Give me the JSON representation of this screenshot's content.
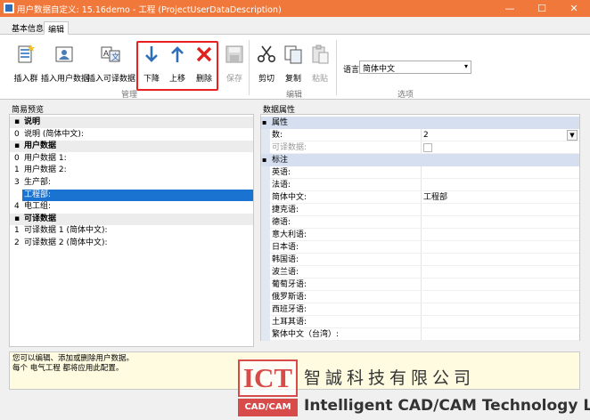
{
  "window": {
    "title": "用户数据自定义: 15.16demo - 工程 (ProjectUserDataDescription)",
    "minimize": "—",
    "maximize": "☐",
    "close": "✕"
  },
  "ribbon_tabs": [
    "基本信息",
    "编辑"
  ],
  "ribbon": {
    "manage": {
      "label": "管理",
      "insert_group": "插入群",
      "insert_user_data": "插入用户数据",
      "insert_translatable": "插入可译数据",
      "move_down": "下降",
      "move_up": "上移",
      "delete": "删除",
      "save": "保存"
    },
    "edit": {
      "label": "编辑",
      "cut": "剪切",
      "copy": "复制",
      "paste": "粘贴"
    },
    "options": {
      "label": "选项",
      "language_label": "语言",
      "language_value": "简体中文"
    }
  },
  "left_pane": {
    "title": "简易预览",
    "rows": [
      {
        "num": "",
        "text": "说明",
        "kind": "header"
      },
      {
        "num": "0",
        "text": "说明 (简体中文):",
        "kind": "row"
      },
      {
        "num": "",
        "text": "用户数据",
        "kind": "header"
      },
      {
        "num": "0",
        "text": "用户数据 1:",
        "kind": "row"
      },
      {
        "num": "1",
        "text": "用户数据 2:",
        "kind": "row"
      },
      {
        "num": "3",
        "text": "生产部:",
        "kind": "row"
      },
      {
        "num": "",
        "text": "工程部:",
        "kind": "selected"
      },
      {
        "num": "4",
        "text": "电工组:",
        "kind": "row"
      },
      {
        "num": "",
        "text": "可译数据",
        "kind": "header"
      },
      {
        "num": "1",
        "text": "可译数据 1 (简体中文):",
        "kind": "row"
      },
      {
        "num": "2",
        "text": "可译数据 2 (简体中文):",
        "kind": "row"
      }
    ]
  },
  "right_pane": {
    "title": "数据属性",
    "category_properties": "属性",
    "count_label": "数:",
    "count_value": "2",
    "translatable_label": "可译数据:",
    "category_label": "标注",
    "labels": [
      {
        "name": "英语:",
        "value": ""
      },
      {
        "name": "法语:",
        "value": ""
      },
      {
        "name": "简体中文:",
        "value": "工程部"
      },
      {
        "name": "捷克语:",
        "value": ""
      },
      {
        "name": "德语:",
        "value": ""
      },
      {
        "name": "意大利语:",
        "value": ""
      },
      {
        "name": "日本语:",
        "value": ""
      },
      {
        "name": "韩国语:",
        "value": ""
      },
      {
        "name": "波兰语:",
        "value": ""
      },
      {
        "name": "葡萄牙语:",
        "value": ""
      },
      {
        "name": "俄罗斯语:",
        "value": ""
      },
      {
        "name": "西班牙语:",
        "value": ""
      },
      {
        "name": "土耳其语:",
        "value": ""
      },
      {
        "name": "繁体中文（台湾）:",
        "value": ""
      }
    ]
  },
  "info": {
    "line1": "您可以编辑、添加或删除用户数据。",
    "line2": "每个 电气工程 都将应用此配置。"
  },
  "watermark": {
    "logo": "ICT",
    "logo_sub": "CAD/CAM",
    "company_cn": "智誠科技有限公司",
    "company_en": "Intelligent CAD/CAM Technology Ltd."
  },
  "colors": {
    "titlebar": "#f0783a",
    "selection": "#1a73d0",
    "highlight_box": "#e82020",
    "category": "#d5dff0"
  }
}
